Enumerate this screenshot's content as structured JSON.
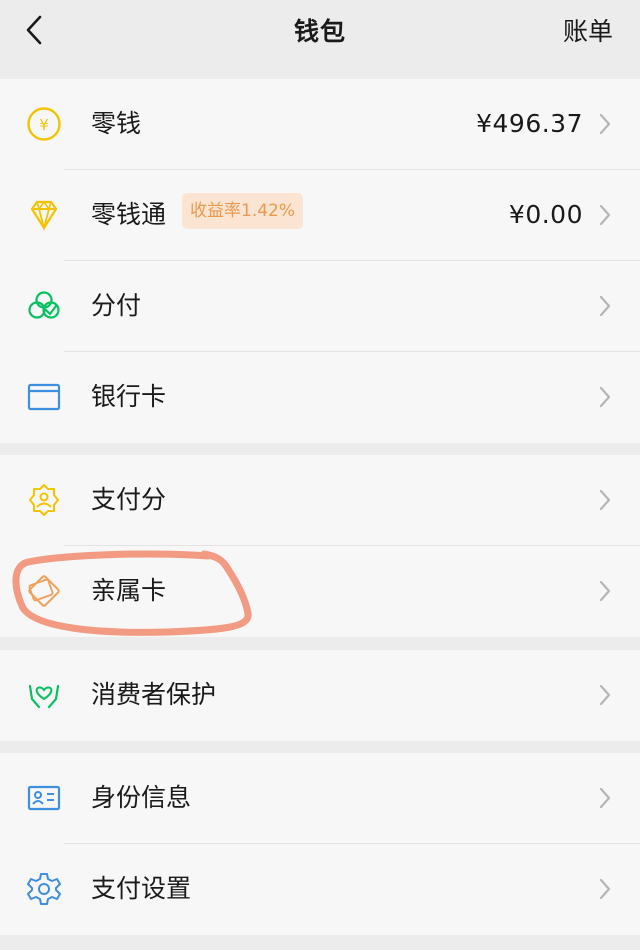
{
  "header": {
    "title": "钱包",
    "right_label": "账单"
  },
  "group1": [
    {
      "label": "零钱",
      "value": "¥496.37",
      "icon": "yuan-coin-icon",
      "color": "#f5c300"
    },
    {
      "label": "零钱通",
      "badge": "收益率1.42%",
      "value": "¥0.00",
      "icon": "diamond-icon",
      "color": "#f5c300"
    },
    {
      "label": "分付",
      "icon": "clover-check-icon",
      "color": "#07c160"
    },
    {
      "label": "银行卡",
      "icon": "card-icon",
      "color": "#3e8fe0"
    }
  ],
  "group2": [
    {
      "label": "支付分",
      "icon": "score-badge-icon",
      "color": "#f5c300"
    },
    {
      "label": "亲属卡",
      "icon": "family-card-icon",
      "color": "#f0a05a"
    }
  ],
  "group3": [
    {
      "label": "消费者保护",
      "icon": "hands-protect-icon",
      "color": "#07c160"
    }
  ],
  "group4": [
    {
      "label": "身份信息",
      "icon": "id-card-icon",
      "color": "#3e8fe0"
    },
    {
      "label": "支付设置",
      "icon": "gear-icon",
      "color": "#3e8fe0"
    }
  ],
  "annotation": {
    "highlight_color": "#f28a6e"
  }
}
